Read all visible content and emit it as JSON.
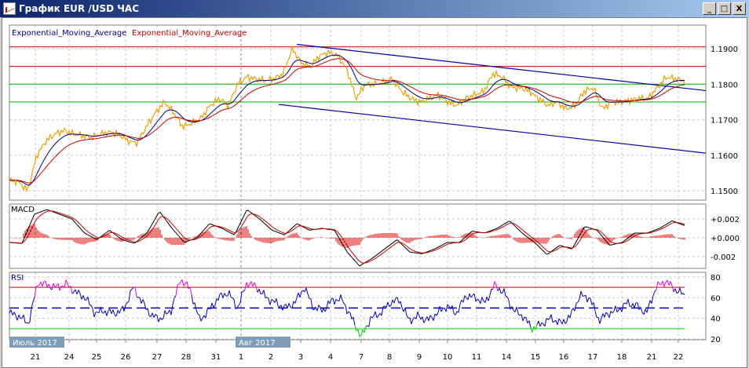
{
  "window": {
    "title": "График EUR /USD  ЧАС",
    "minimize": "_",
    "maximize": "□",
    "close": "X"
  },
  "legend": {
    "ema_blue": "Exponential_Moving_Average",
    "ema_red": "Exponential_Moving_Average"
  },
  "colors": {
    "price": "#f0a000",
    "ema_fast": "#000080",
    "ema_slow": "#cc0000",
    "channel": "#0000a0",
    "resistance": "#cc0000",
    "support": "#00b000",
    "macd": "#000000",
    "signal": "#cc0000",
    "hist": "#dd0000",
    "rsi": "#0000c0",
    "rsi_ob": "#e000e0",
    "rsi_os": "#00cc00"
  },
  "chart_data": [
    {
      "type": "line",
      "title": "EUR/USD H1",
      "ylim": [
        1.146,
        1.195
      ],
      "yticks": [
        "1.1900",
        "1.1800",
        "1.1700",
        "1.1600",
        "1.1500"
      ],
      "hlines_red": [
        1.1905,
        1.185
      ],
      "hlines_green": [
        1.18,
        1.175
      ],
      "price": [
        1.153,
        1.1525,
        1.15,
        1.16,
        1.164,
        1.166,
        1.167,
        1.166,
        1.1655,
        1.165,
        1.166,
        1.1665,
        1.166,
        1.164,
        1.1635,
        1.168,
        1.172,
        1.175,
        1.172,
        1.168,
        1.169,
        1.1705,
        1.174,
        1.176,
        1.174,
        1.18,
        1.182,
        1.1815,
        1.181,
        1.1815,
        1.183,
        1.19,
        1.186,
        1.185,
        1.188,
        1.189,
        1.188,
        1.184,
        1.176,
        1.18,
        1.18,
        1.1805,
        1.1815,
        1.178,
        1.176,
        1.175,
        1.176,
        1.177,
        1.175,
        1.174,
        1.176,
        1.177,
        1.178,
        1.183,
        1.182,
        1.179,
        1.179,
        1.178,
        1.176,
        1.174,
        1.175,
        1.173,
        1.174,
        1.178,
        1.179,
        1.173,
        1.175,
        1.175,
        1.1755,
        1.176,
        1.176,
        1.179,
        1.182,
        1.1815,
        1.181
      ],
      "channel_upper": [
        1.1912,
        1.1782
      ],
      "channel_lower": [
        1.1743,
        1.1606
      ]
    },
    {
      "type": "line",
      "title": "MACD",
      "ylim": [
        -0.0032,
        0.0036
      ],
      "yticks": [
        "+0.002",
        "+0.000",
        "-0.002"
      ],
      "macd": [
        -0.0005,
        -0.0006,
        0.0025,
        0.003,
        0.0025,
        0.002,
        0.0005,
        -0.0002,
        0.0008,
        -0.0002,
        -0.0006,
        0.0005,
        0.0028,
        0.001,
        -0.0005,
        0.0,
        0.0015,
        0.001,
        0.0003,
        0.003,
        0.002,
        0.0008,
        0.0003,
        0.0015,
        0.0008,
        0.001,
        0.0008,
        -0.0015,
        -0.003,
        -0.0022,
        -0.0012,
        -0.0002,
        -0.0015,
        -0.0017,
        -0.0012,
        -0.0005,
        -0.0005,
        0.0007,
        0.0005,
        0.001,
        0.0018,
        0.0005,
        -0.0005,
        -0.0018,
        -0.0008,
        -0.0012,
        0.0012,
        0.0008,
        -0.0008,
        -0.0005,
        0.0005,
        0.0005,
        0.001,
        0.0018,
        0.0013
      ]
    },
    {
      "type": "line",
      "title": "RSI",
      "ylim": [
        18,
        82
      ],
      "levels": [
        70,
        50,
        30
      ],
      "yticks": [
        "80",
        "60",
        "40",
        "20"
      ],
      "rsi": [
        45,
        42,
        35,
        75,
        72,
        70,
        73,
        65,
        60,
        45,
        47,
        45,
        48,
        70,
        55,
        42,
        40,
        48,
        78,
        68,
        38,
        48,
        60,
        65,
        50,
        75,
        70,
        60,
        55,
        50,
        55,
        70,
        50,
        48,
        58,
        58,
        40,
        22,
        40,
        45,
        55,
        58,
        38,
        42,
        38,
        45,
        52,
        45,
        62,
        60,
        55,
        72,
        65,
        48,
        42,
        30,
        35,
        40,
        35,
        42,
        62,
        60,
        38,
        45,
        48,
        55,
        52,
        45,
        70,
        76,
        68,
        62
      ]
    },
    {
      "xticks": [
        "21",
        "24",
        "25",
        "26",
        "27",
        "28",
        "31",
        "1",
        "2",
        "3",
        "4",
        "7",
        "8",
        "9",
        "10",
        "11",
        "14",
        "15",
        "16",
        "17",
        "18",
        "21",
        "22"
      ],
      "month_labels": [
        "Июль 2017",
        "Авг 2017"
      ]
    }
  ]
}
